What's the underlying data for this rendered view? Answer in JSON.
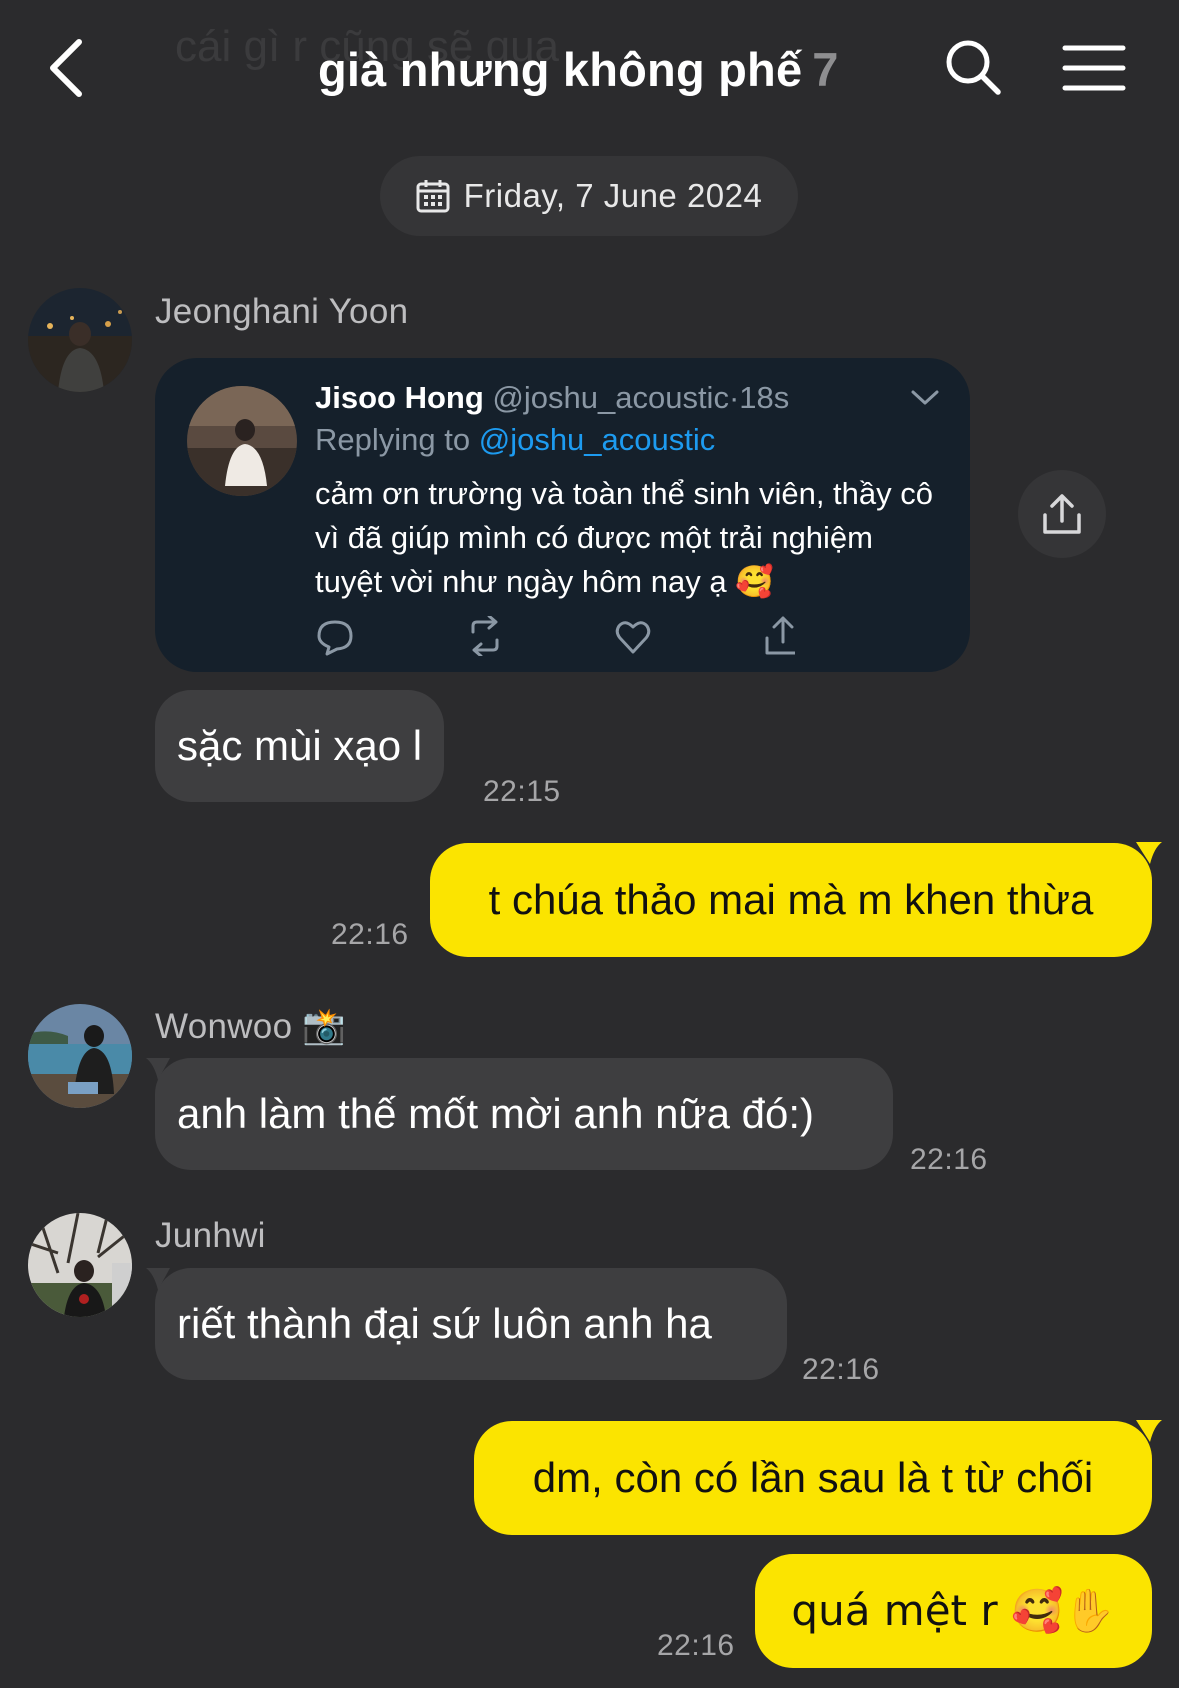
{
  "header": {
    "faded_text": "cái gì r cũng sẽ qua",
    "title": "già nhưng không phế",
    "member_count": "7"
  },
  "date_pill": {
    "label": "Friday, 7 June 2024"
  },
  "messages": [
    {
      "sender": "Jeonghani Yoon",
      "tweet": {
        "name": "Jisoo Hong",
        "handle": "@joshu_acoustic",
        "time": "·18s",
        "replying_prefix": "Replying to ",
        "replying_handle": "@joshu_acoustic",
        "text": "cảm ơn trường và toàn thể sinh viên, thầy cô vì đã giúp mình có được một trải nghiệm tuyệt vời như ngày hôm nay ạ 🥰"
      }
    },
    {
      "text": "sặc mùi xạo l",
      "time": "22:15"
    },
    {
      "text": "t chúa thảo mai mà m khen thừa",
      "time": "22:16"
    },
    {
      "sender": "Wonwoo",
      "sender_emoji": "📸",
      "text": "anh làm thế mốt mời anh nữa đó:)",
      "time": "22:16"
    },
    {
      "sender": "Junhwi",
      "text": "riết thành đại sứ luôn anh ha",
      "time": "22:16"
    },
    {
      "text": "dm, còn có lần sau là t từ chối"
    },
    {
      "text": "quá mệt r 🥰✋",
      "time": "22:16"
    }
  ]
}
